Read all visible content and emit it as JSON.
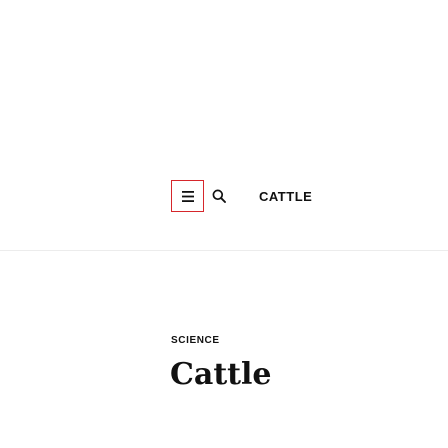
{
  "header": {
    "menu_icon": "hamburger-menu-icon",
    "search_icon": "search-icon",
    "title": "CATTLE",
    "accent_color": "#d6262b"
  },
  "article": {
    "section": "SCIENCE",
    "title": "Cattle"
  }
}
